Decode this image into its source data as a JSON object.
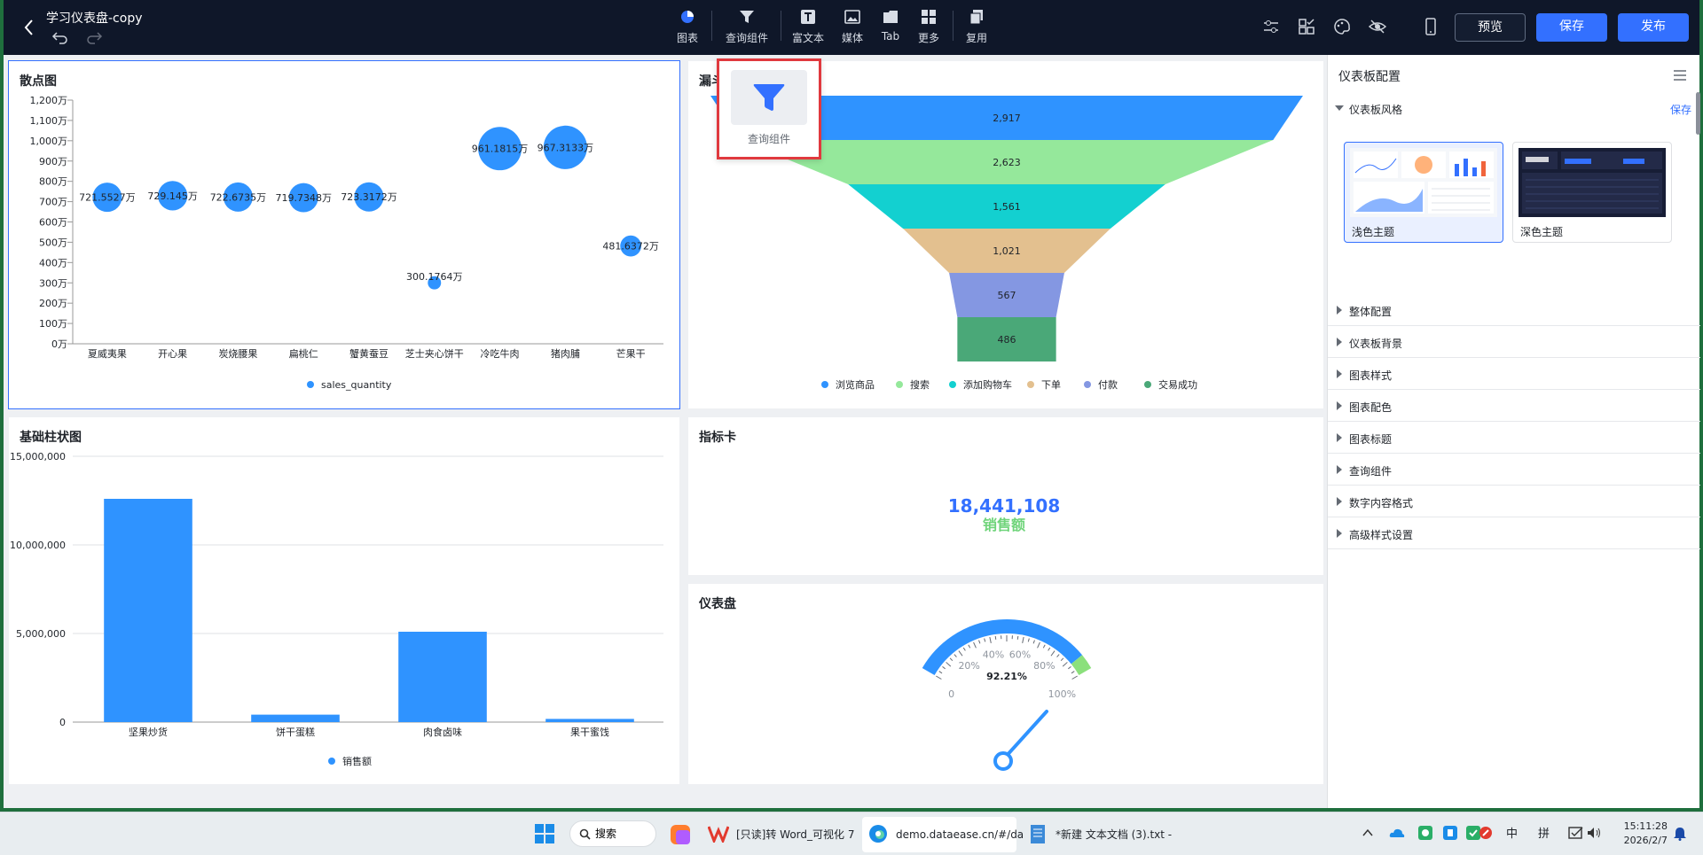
{
  "app": {
    "title": "学习仪表盘-copy"
  },
  "toolbar": {
    "items": [
      "图表",
      "查询组件",
      "富文本",
      "媒体",
      "Tab",
      "更多",
      "复用"
    ],
    "preview": "预览",
    "save": "保存",
    "publish": "发布"
  },
  "popup": {
    "label": "查询组件"
  },
  "scatter": {
    "title": "散点图",
    "legend": "sales_quantity",
    "chart_data": {
      "type": "scatter",
      "categories": [
        "夏威夷果",
        "开心果",
        "炭烧腰果",
        "扁桃仁",
        "蟹黄蚕豆",
        "芝士夹心饼干",
        "冷吃牛肉",
        "猪肉脯",
        "芒果干"
      ],
      "values": [
        721.5527,
        729.145,
        722.6735,
        719.7348,
        723.3172,
        300.1764,
        961.1815,
        967.3133,
        481.6372
      ],
      "labels": [
        "721.5527万",
        "729.145万",
        "722.6735万",
        "719.7348万",
        "723.3172万",
        "300.1764万",
        "961.1815万",
        "967.3133万",
        "481.6372万"
      ],
      "yticks": [
        "0万",
        "100万",
        "200万",
        "300万",
        "400万",
        "500万",
        "600万",
        "700万",
        "800万",
        "900万",
        "1,000万",
        "1,100万",
        "1,200万"
      ],
      "ylim": [
        0,
        1200
      ],
      "series": [
        {
          "name": "sales_quantity"
        }
      ]
    }
  },
  "funnel": {
    "title": "漏斗图",
    "chart_data": {
      "type": "funnel",
      "categories": [
        "浏览商品",
        "搜索",
        "添加购物车",
        "下单",
        "付款",
        "交易成功"
      ],
      "values": [
        2917,
        2623,
        1561,
        1021,
        567,
        486
      ],
      "labels": [
        "2,917",
        "2,623",
        "1,561",
        "1,021",
        "567",
        "486"
      ],
      "colors": [
        "#2f93ff",
        "#95e89b",
        "#13d0d0",
        "#e3c08f",
        "#8497e2",
        "#4aa878"
      ]
    }
  },
  "bar": {
    "title": "基础柱状图",
    "legend": "销售额",
    "chart_data": {
      "type": "bar",
      "categories": [
        "坚果炒货",
        "饼干蛋糕",
        "肉食卤味",
        "果干蜜饯"
      ],
      "values": [
        12600000,
        420000,
        5100000,
        180000
      ],
      "yticks": [
        "0",
        "5,000,000",
        "10,000,000",
        "15,000,000"
      ],
      "ylim": [
        0,
        15000000
      ],
      "series": [
        {
          "name": "销售额"
        }
      ]
    }
  },
  "kpi": {
    "title": "指标卡",
    "value": "18,441,108",
    "label": "销售额"
  },
  "gauge": {
    "title": "仪表盘",
    "chart_data": {
      "type": "gauge",
      "value": 92.21,
      "value_label": "92.21%",
      "ticks": [
        "0",
        "20%",
        "40%",
        "60%",
        "80%",
        "100%"
      ]
    }
  },
  "config": {
    "title": "仪表板配置",
    "style_section": "仪表板风格",
    "save_link": "保存",
    "themes": [
      "浅色主题",
      "深色主题"
    ],
    "sections": [
      "整体配置",
      "仪表板背景",
      "图表样式",
      "图表配色",
      "图表标题",
      "查询组件",
      "数字内容格式",
      "高级样式设置"
    ]
  },
  "taskbar": {
    "search": "搜索",
    "word": "[只读]转 Word_可视化 7",
    "edge": "demo.dataease.cn/#/da",
    "notepad": "*新建 文本文档 (3).txt - ",
    "ime1": "中",
    "ime2": "拼",
    "time": "15:11:28",
    "date": "2026/2/7"
  },
  "colors": {
    "accent": "#3370ff",
    "series": "#2f93ff",
    "dark_bar": "#0f1729"
  }
}
